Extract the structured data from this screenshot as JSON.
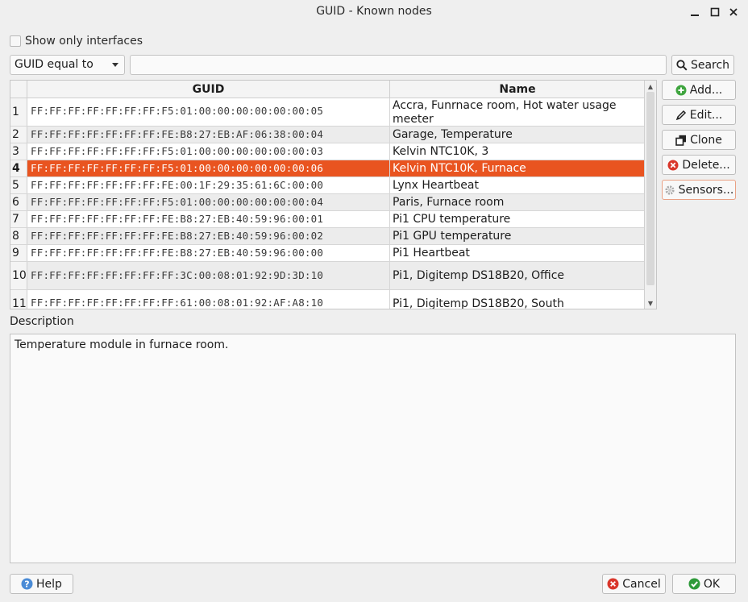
{
  "window": {
    "title": "GUID - Known nodes",
    "minimize_icon": "minimize-icon",
    "maximize_icon": "maximize-icon",
    "close_icon": "close-icon"
  },
  "filter": {
    "show_only_interfaces_label": "Show only interfaces",
    "show_only_interfaces_checked": false,
    "combo_value": "GUID equal to",
    "search_value": "",
    "search_button": "Search"
  },
  "table": {
    "columns": [
      "GUID",
      "Name"
    ],
    "selected_row": 4,
    "rows": [
      {
        "num": "1",
        "guid": "FF:FF:FF:FF:FF:FF:FF:F5:01:00:00:00:00:00:00:05",
        "name": "Accra, Funrnace room, Hot water usage meeter"
      },
      {
        "num": "2",
        "guid": "FF:FF:FF:FF:FF:FF:FF:FE:B8:27:EB:AF:06:38:00:04",
        "name": "Garage, Temperature"
      },
      {
        "num": "3",
        "guid": "FF:FF:FF:FF:FF:FF:FF:F5:01:00:00:00:00:00:00:03",
        "name": "Kelvin NTC10K, 3"
      },
      {
        "num": "4",
        "guid": "FF:FF:FF:FF:FF:FF:FF:F5:01:00:00:00:00:00:00:06",
        "name": "Kelvin NTC10K, Furnace"
      },
      {
        "num": "5",
        "guid": "FF:FF:FF:FF:FF:FF:FF:FE:00:1F:29:35:61:6C:00:00",
        "name": "Lynx Heartbeat"
      },
      {
        "num": "6",
        "guid": "FF:FF:FF:FF:FF:FF:FF:F5:01:00:00:00:00:00:00:04",
        "name": "Paris, Furnace room"
      },
      {
        "num": "7",
        "guid": "FF:FF:FF:FF:FF:FF:FF:FE:B8:27:EB:40:59:96:00:01",
        "name": "Pi1 CPU temperature"
      },
      {
        "num": "8",
        "guid": "FF:FF:FF:FF:FF:FF:FF:FE:B8:27:EB:40:59:96:00:02",
        "name": "Pi1 GPU temperature"
      },
      {
        "num": "9",
        "guid": "FF:FF:FF:FF:FF:FF:FF:FE:B8:27:EB:40:59:96:00:00",
        "name": "Pi1 Heartbeat"
      },
      {
        "num": "10",
        "guid": "FF:FF:FF:FF:FF:FF:FF:FF:3C:00:08:01:92:9D:3D:10",
        "name": "Pi1, Digitemp DS18B20, Office"
      },
      {
        "num": "11",
        "guid": "FF:FF:FF:FF:FF:FF:FF:FF:61:00:08:01:92:AF:A8:10",
        "name": "Pi1, Digitemp DS18B20, South"
      }
    ]
  },
  "side_buttons": {
    "add": "Add...",
    "edit": "Edit...",
    "clone": "Clone",
    "delete": "Delete...",
    "sensors": "Sensors..."
  },
  "description": {
    "label": "Description",
    "text": "Temperature module in furnace room."
  },
  "footer": {
    "help": "Help",
    "cancel": "Cancel",
    "ok": "OK"
  },
  "colors": {
    "selection": "#e95420",
    "add_icon": "#3fa53f",
    "delete_icon": "#d9362b",
    "ok_icon": "#2e9a3a",
    "help_icon": "#4a8bd6"
  }
}
